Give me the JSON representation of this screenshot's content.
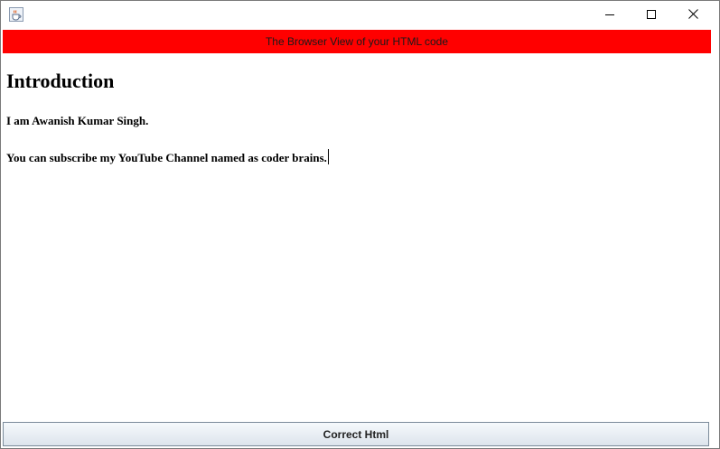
{
  "window": {
    "controls": {
      "minimize_icon": "minimize-icon",
      "maximize_icon": "maximize-icon",
      "close_icon": "close-icon"
    },
    "app_icon": "java-cup-icon"
  },
  "banner": {
    "text": "The Browser View of your HTML code",
    "background": "#ff0000"
  },
  "content": {
    "heading": "Introduction",
    "paragraphs": [
      "I am Awanish Kumar Singh.",
      "You can subscribe my YouTube Channel named as coder brains."
    ]
  },
  "footer": {
    "button_label": "Correct Html"
  }
}
